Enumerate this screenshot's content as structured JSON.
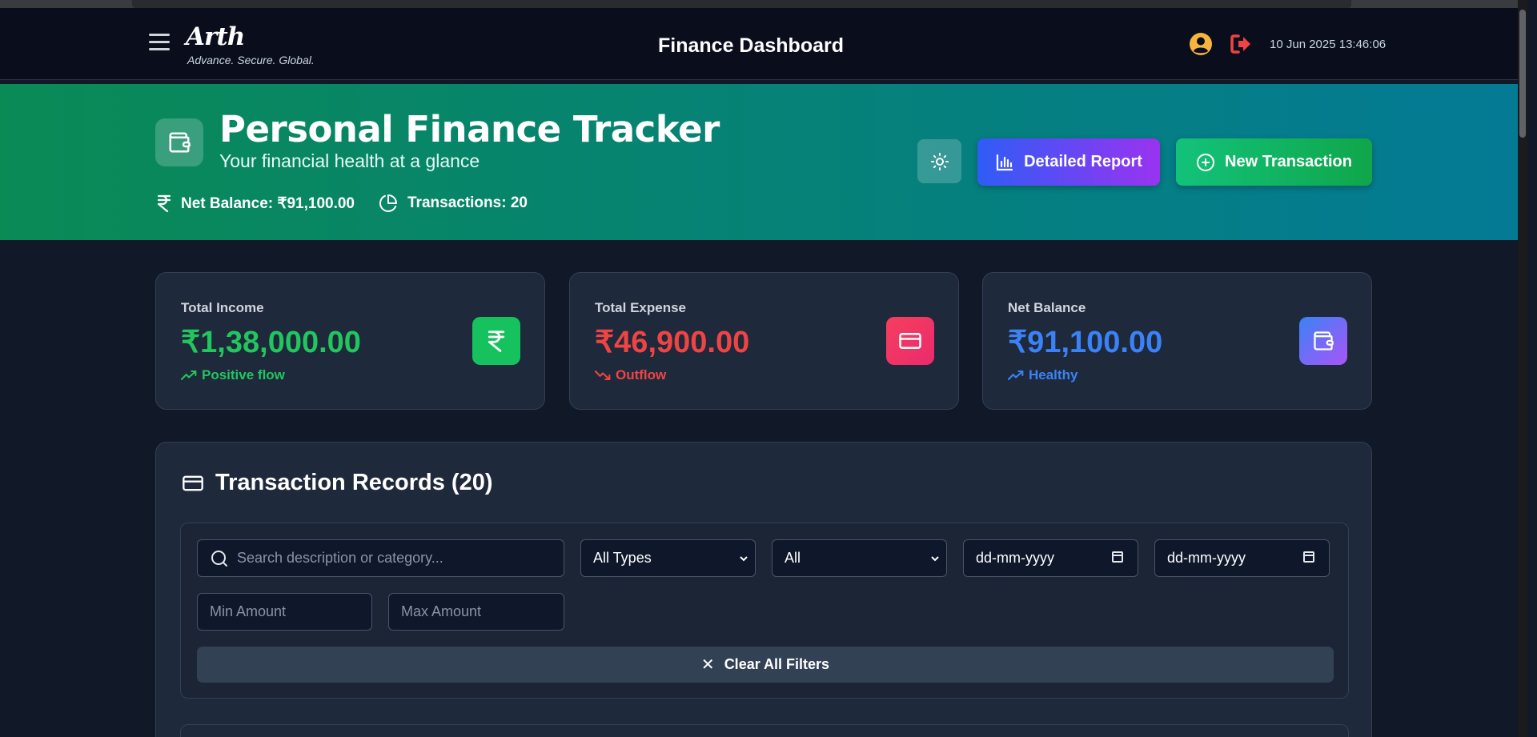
{
  "header": {
    "logo": "Arth",
    "tagline": "Advance. Secure. Global.",
    "title": "Finance Dashboard",
    "datetime": "10 Jun 2025 13:46:06"
  },
  "hero": {
    "title": "Personal Finance Tracker",
    "subtitle": "Your financial health at a glance",
    "net_balance": "Net Balance: ₹91,100.00",
    "transactions": "Transactions: 20",
    "report_button": "Detailed Report",
    "new_button": "New Transaction"
  },
  "cards": [
    {
      "label": "Total Income",
      "value": "₹1,38,000.00",
      "trend": "Positive flow",
      "color": "#22c55e"
    },
    {
      "label": "Total Expense",
      "value": "₹46,900.00",
      "trend": "Outflow",
      "color": "#ef4444"
    },
    {
      "label": "Net Balance",
      "value": "₹91,100.00",
      "trend": "Healthy",
      "color": "#3b82f6"
    }
  ],
  "records": {
    "title": "Transaction Records (20)",
    "search_placeholder": "Search description or category...",
    "type_select": "All Types",
    "category_select": "All",
    "date_from": "dd-mm-yyyy",
    "date_to": "dd-mm-yyyy",
    "min_placeholder": "Min Amount",
    "max_placeholder": "Max Amount",
    "clear_button": "Clear All Filters"
  }
}
